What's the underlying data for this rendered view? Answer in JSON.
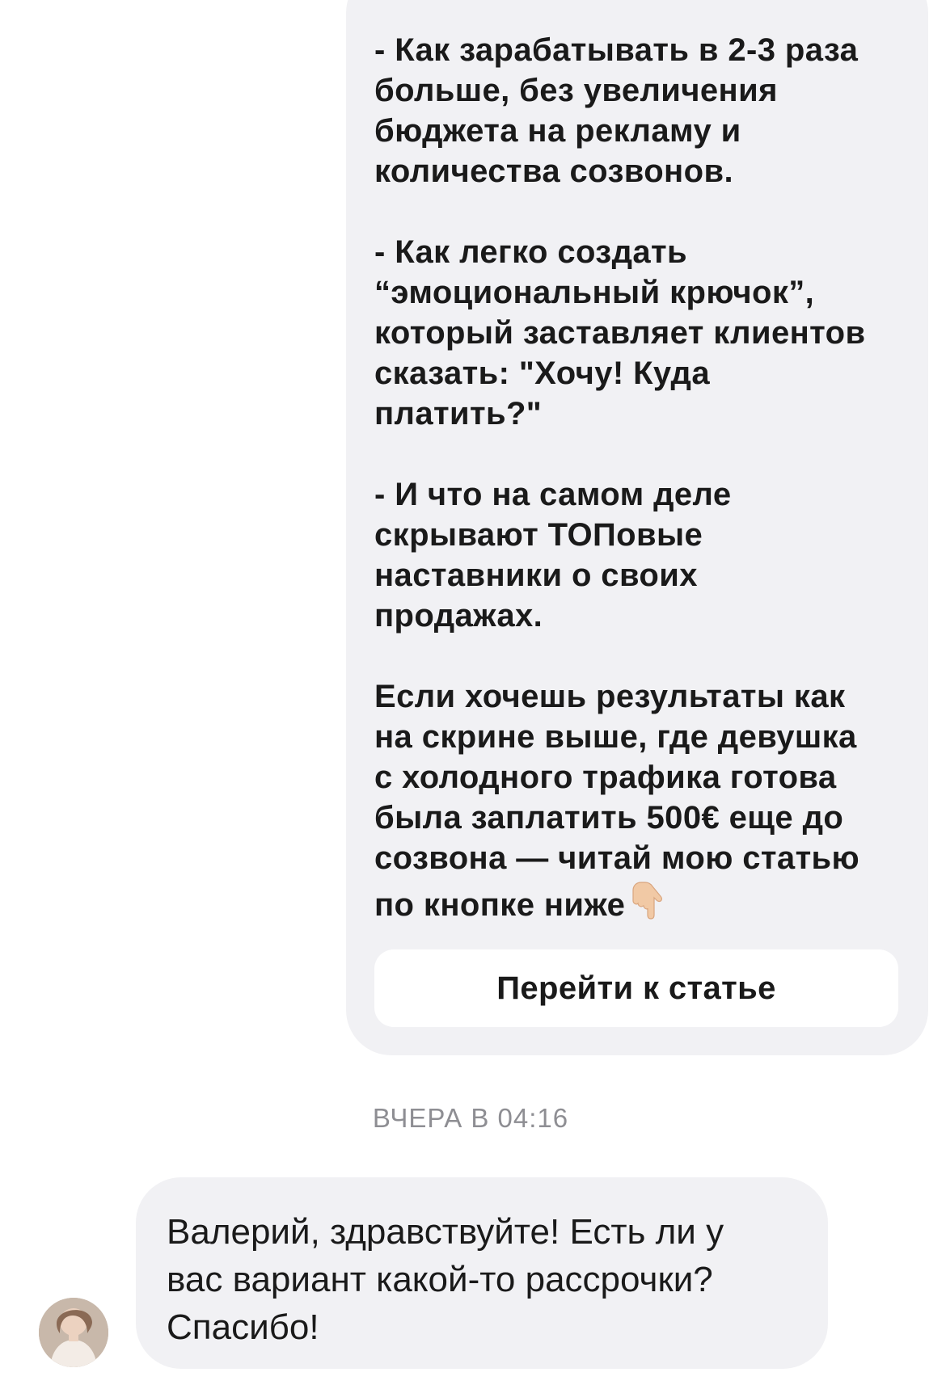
{
  "outgoing_message": {
    "paragraphs": [
      {
        "lines": [
          "- Как зарабатывать в 2-3 раза",
          "больше, без увеличения",
          "бюджета на рекламу и",
          "количества созвонов."
        ]
      },
      {
        "lines": [
          "- Как легко создать",
          "“эмоциональный крючок”,",
          "который заставляет клиентов",
          "сказать: \"Хочу! Куда",
          "платить?\""
        ]
      },
      {
        "lines": [
          "- И что на самом деле",
          "скрывают ТОПовые",
          "наставники о своих",
          "продажах."
        ]
      },
      {
        "lines": [
          "Если хочешь результаты как",
          "на скрине выше, где девушка",
          "с холодного трафика готова",
          "была заплатить 500€ еще до",
          "созвона — читай мою статью",
          "по кнопке ниже"
        ]
      }
    ],
    "trailing_icon": "hand-pointing-down-icon",
    "button_label": "Перейти к статье"
  },
  "timestamp": "ВЧЕРА В 04:16",
  "incoming_message": {
    "lines": [
      "Валерий, здравствуйте! Есть ли у",
      "вас вариант какой-то рассрочки?",
      "Спасибо!"
    ],
    "avatar_icon": "user-avatar"
  },
  "colors": {
    "bubble": "#f1f1f4",
    "text": "#1a1a1a",
    "timestamp": "#8e8e93",
    "button": "#ffffff"
  }
}
